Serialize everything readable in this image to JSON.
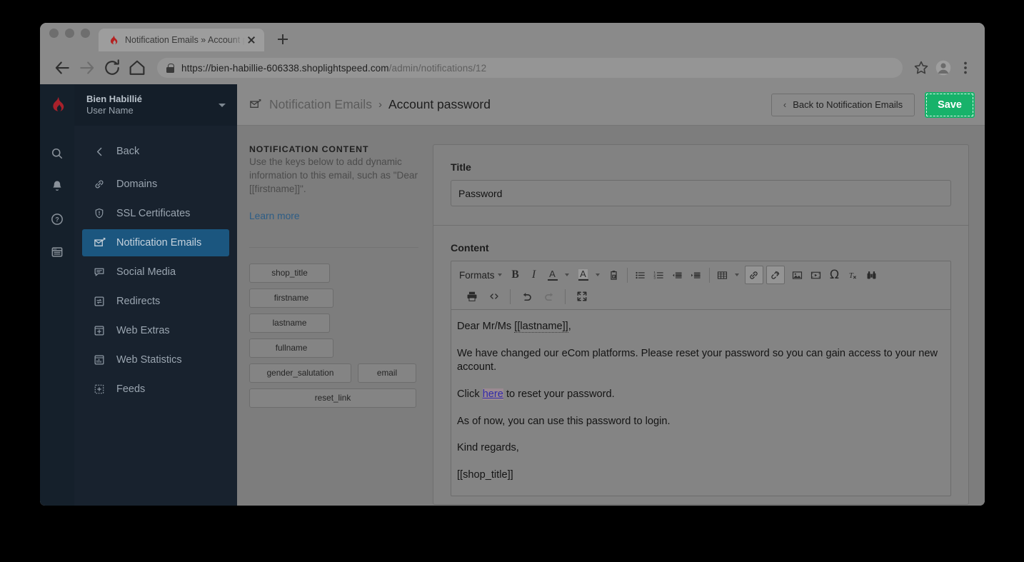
{
  "browser": {
    "tab": {
      "title": "Notification Emails » Account p",
      "favicon_icon": "lightspeed-flame-icon",
      "close_icon": "close-icon"
    },
    "new_tab_icon": "plus-icon",
    "nav": {
      "back_icon": "arrow-left-icon",
      "forward_icon": "arrow-right-icon",
      "reload_icon": "reload-icon",
      "home_icon": "home-icon"
    },
    "omnibox": {
      "lock_icon": "lock-icon",
      "url_secure": "https://bien-habillie-606338.shoplightspeed.com",
      "url_path": "/admin/notifications/12"
    },
    "actions": {
      "bookmark_icon": "star-icon",
      "profile_icon": "avatar-icon",
      "menu_icon": "kebab-menu-icon"
    }
  },
  "rail": {
    "logo_icon": "lightspeed-flame-icon",
    "items": [
      {
        "icon": "search-icon",
        "name": "search"
      },
      {
        "icon": "bell-icon",
        "name": "notifications"
      },
      {
        "icon": "help-circle-icon",
        "name": "help"
      },
      {
        "icon": "browser-window-icon",
        "name": "webshop"
      }
    ]
  },
  "sidebar": {
    "account": {
      "shop": "Bien Habillié",
      "user": "User Name",
      "caret_icon": "chevron-down-icon"
    },
    "items": [
      {
        "label": "Back",
        "icon": "chevron-left-icon",
        "active": false
      },
      {
        "label": "Domains",
        "icon": "link-icon",
        "active": false
      },
      {
        "label": "SSL Certificates",
        "icon": "shield-icon",
        "active": false
      },
      {
        "label": "Notification Emails",
        "icon": "mail-edit-icon",
        "active": true
      },
      {
        "label": "Social Media",
        "icon": "chat-icon",
        "active": false
      },
      {
        "label": "Redirects",
        "icon": "redirect-icon",
        "active": false
      },
      {
        "label": "Web Extras",
        "icon": "plus-box-icon",
        "active": false
      },
      {
        "label": "Web Statistics",
        "icon": "chart-box-icon",
        "active": false
      },
      {
        "label": "Feeds",
        "icon": "feeds-icon",
        "active": false
      }
    ]
  },
  "topbar": {
    "breadcrumb_icon": "mail-edit-icon",
    "breadcrumb_parent": "Notification Emails",
    "breadcrumb_sep": "›",
    "breadcrumb_current": "Account password",
    "back_button": "Back to Notification Emails",
    "back_chevron": "‹",
    "save_button": "Save",
    "save_color": "#17b26a"
  },
  "left_panel": {
    "section_title": "NOTIFICATION CONTENT",
    "description": "Use the keys below to add dynamic information to this email, such as \"Dear [[firstname]]\".",
    "learn_more": "Learn more",
    "keys": [
      "shop_title",
      "firstname",
      "lastname",
      "fullname",
      "gender_salutation",
      "email",
      "reset_link"
    ]
  },
  "form": {
    "title_label": "Title",
    "title_value": "Password",
    "content_label": "Content"
  },
  "editor": {
    "toolbar_row1": [
      {
        "name": "formats-dropdown",
        "label": "Formats",
        "icon": "text-dropdown-icon",
        "type": "text-dropdown"
      },
      {
        "name": "bold-button",
        "label": "B",
        "icon": "bold-icon",
        "type": "bold"
      },
      {
        "name": "italic-button",
        "label": "I",
        "icon": "italic-icon",
        "type": "italic"
      },
      {
        "name": "text-color-button",
        "label": "A",
        "icon": "text-color-icon",
        "type": "textcolor"
      },
      {
        "name": "background-color-button",
        "label": "A",
        "icon": "background-color-icon",
        "type": "bgcolor"
      },
      {
        "name": "paste-as-text-button",
        "label": "",
        "icon": "paste-text-icon",
        "type": "paste"
      },
      {
        "name": "bullet-list-button",
        "label": "",
        "icon": "bullet-list-icon",
        "type": "ul"
      },
      {
        "name": "numbered-list-button",
        "label": "",
        "icon": "numbered-list-icon",
        "type": "ol"
      },
      {
        "name": "outdent-button",
        "label": "",
        "icon": "outdent-icon",
        "type": "outdent"
      },
      {
        "name": "indent-button",
        "label": "",
        "icon": "indent-icon",
        "type": "indent"
      },
      {
        "name": "table-button",
        "label": "",
        "icon": "table-icon",
        "type": "table"
      },
      {
        "name": "insert-link-button",
        "label": "",
        "icon": "link-chain-icon",
        "type": "link",
        "active": true
      },
      {
        "name": "remove-link-button",
        "label": "",
        "icon": "broken-chain-icon",
        "type": "unlink",
        "active": true
      },
      {
        "name": "insert-image-button",
        "label": "",
        "icon": "image-icon",
        "type": "image"
      },
      {
        "name": "insert-media-button",
        "label": "",
        "icon": "media-film-icon",
        "type": "media"
      },
      {
        "name": "special-character-button",
        "label": "Ω",
        "icon": "omega-icon",
        "type": "omega"
      },
      {
        "name": "clear-formatting-button",
        "label": "",
        "icon": "clear-format-icon",
        "type": "clearfmt"
      },
      {
        "name": "find-replace-button",
        "label": "",
        "icon": "binoculars-icon",
        "type": "find"
      }
    ],
    "toolbar_row2": [
      {
        "name": "print-button",
        "label": "",
        "icon": "printer-icon",
        "type": "print"
      },
      {
        "name": "source-code-button",
        "label": "",
        "icon": "source-code-icon",
        "type": "code"
      },
      {
        "name": "undo-button",
        "label": "",
        "icon": "undo-arrow-icon",
        "type": "undo"
      },
      {
        "name": "redo-button",
        "label": "",
        "icon": "redo-arrow-icon",
        "type": "redo",
        "disabled": true
      },
      {
        "name": "fullscreen-button",
        "label": "",
        "icon": "fullscreen-icon",
        "type": "fullscreen"
      }
    ],
    "content": {
      "p1_before": "Dear Mr/Ms ",
      "p1_token": "[[lastname]]",
      "p1_after": ",",
      "p2": "We have changed our eCom platforms. Please reset your password so you can gain access to your new account.",
      "p3_before": "Click ",
      "p3_link": "here",
      "p3_after": " to reset your password.",
      "p4": "As of now, you can use this password to login.",
      "p5": "Kind regards,",
      "p6": "[[shop_title]]"
    }
  }
}
